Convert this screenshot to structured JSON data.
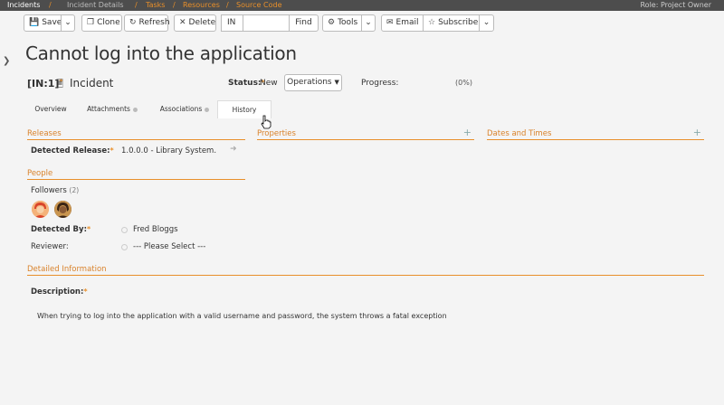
{
  "breadcrumb": {
    "incidents": "Incidents",
    "incident_details": "Incident Details",
    "tasks": "Tasks",
    "resources": "Resources",
    "source_code": "Source Code",
    "role": "Role: Project Owner"
  },
  "toolbar": {
    "save": "Save",
    "clone": "Clone",
    "refresh": "Refresh",
    "delete": "Delete",
    "in_prefix": "IN",
    "find": "Find",
    "tools": "Tools",
    "email": "Email",
    "subscribe": "Subscribe"
  },
  "artifact": {
    "title": "Cannot log into the application",
    "id": "[IN:1]",
    "type": "Incident",
    "status_label": "Status:",
    "status_value": "New",
    "workflow_button": "Operations",
    "progress_label": "Progress:",
    "progress_value": "(0%)"
  },
  "tabs": [
    {
      "label": "Overview"
    },
    {
      "label": "Attachments"
    },
    {
      "label": "Associations"
    },
    {
      "label": "History"
    }
  ],
  "sections": {
    "releases": "Releases",
    "properties": "Properties",
    "dates_times": "Dates and Times",
    "people": "People",
    "detailed_info": "Detailed Information"
  },
  "fields": {
    "detected_release_label": "Detected Release:",
    "detected_release_value": "1.0.0.0 - Library System.",
    "followers_label": "Followers",
    "followers_count": "(2)",
    "detected_by_label": "Detected By:",
    "detected_by_value": "Fred Bloggs",
    "reviewer_label": "Reviewer:",
    "reviewer_value": "--- Please Select ---",
    "description_label": "Description:",
    "description_value": "When trying to log into the application with a valid username and password, the system throws a fatal exception"
  },
  "colors": {
    "accent": "#e88f2a",
    "topbar": "#4d4d4d",
    "background": "#f4f4f4"
  }
}
